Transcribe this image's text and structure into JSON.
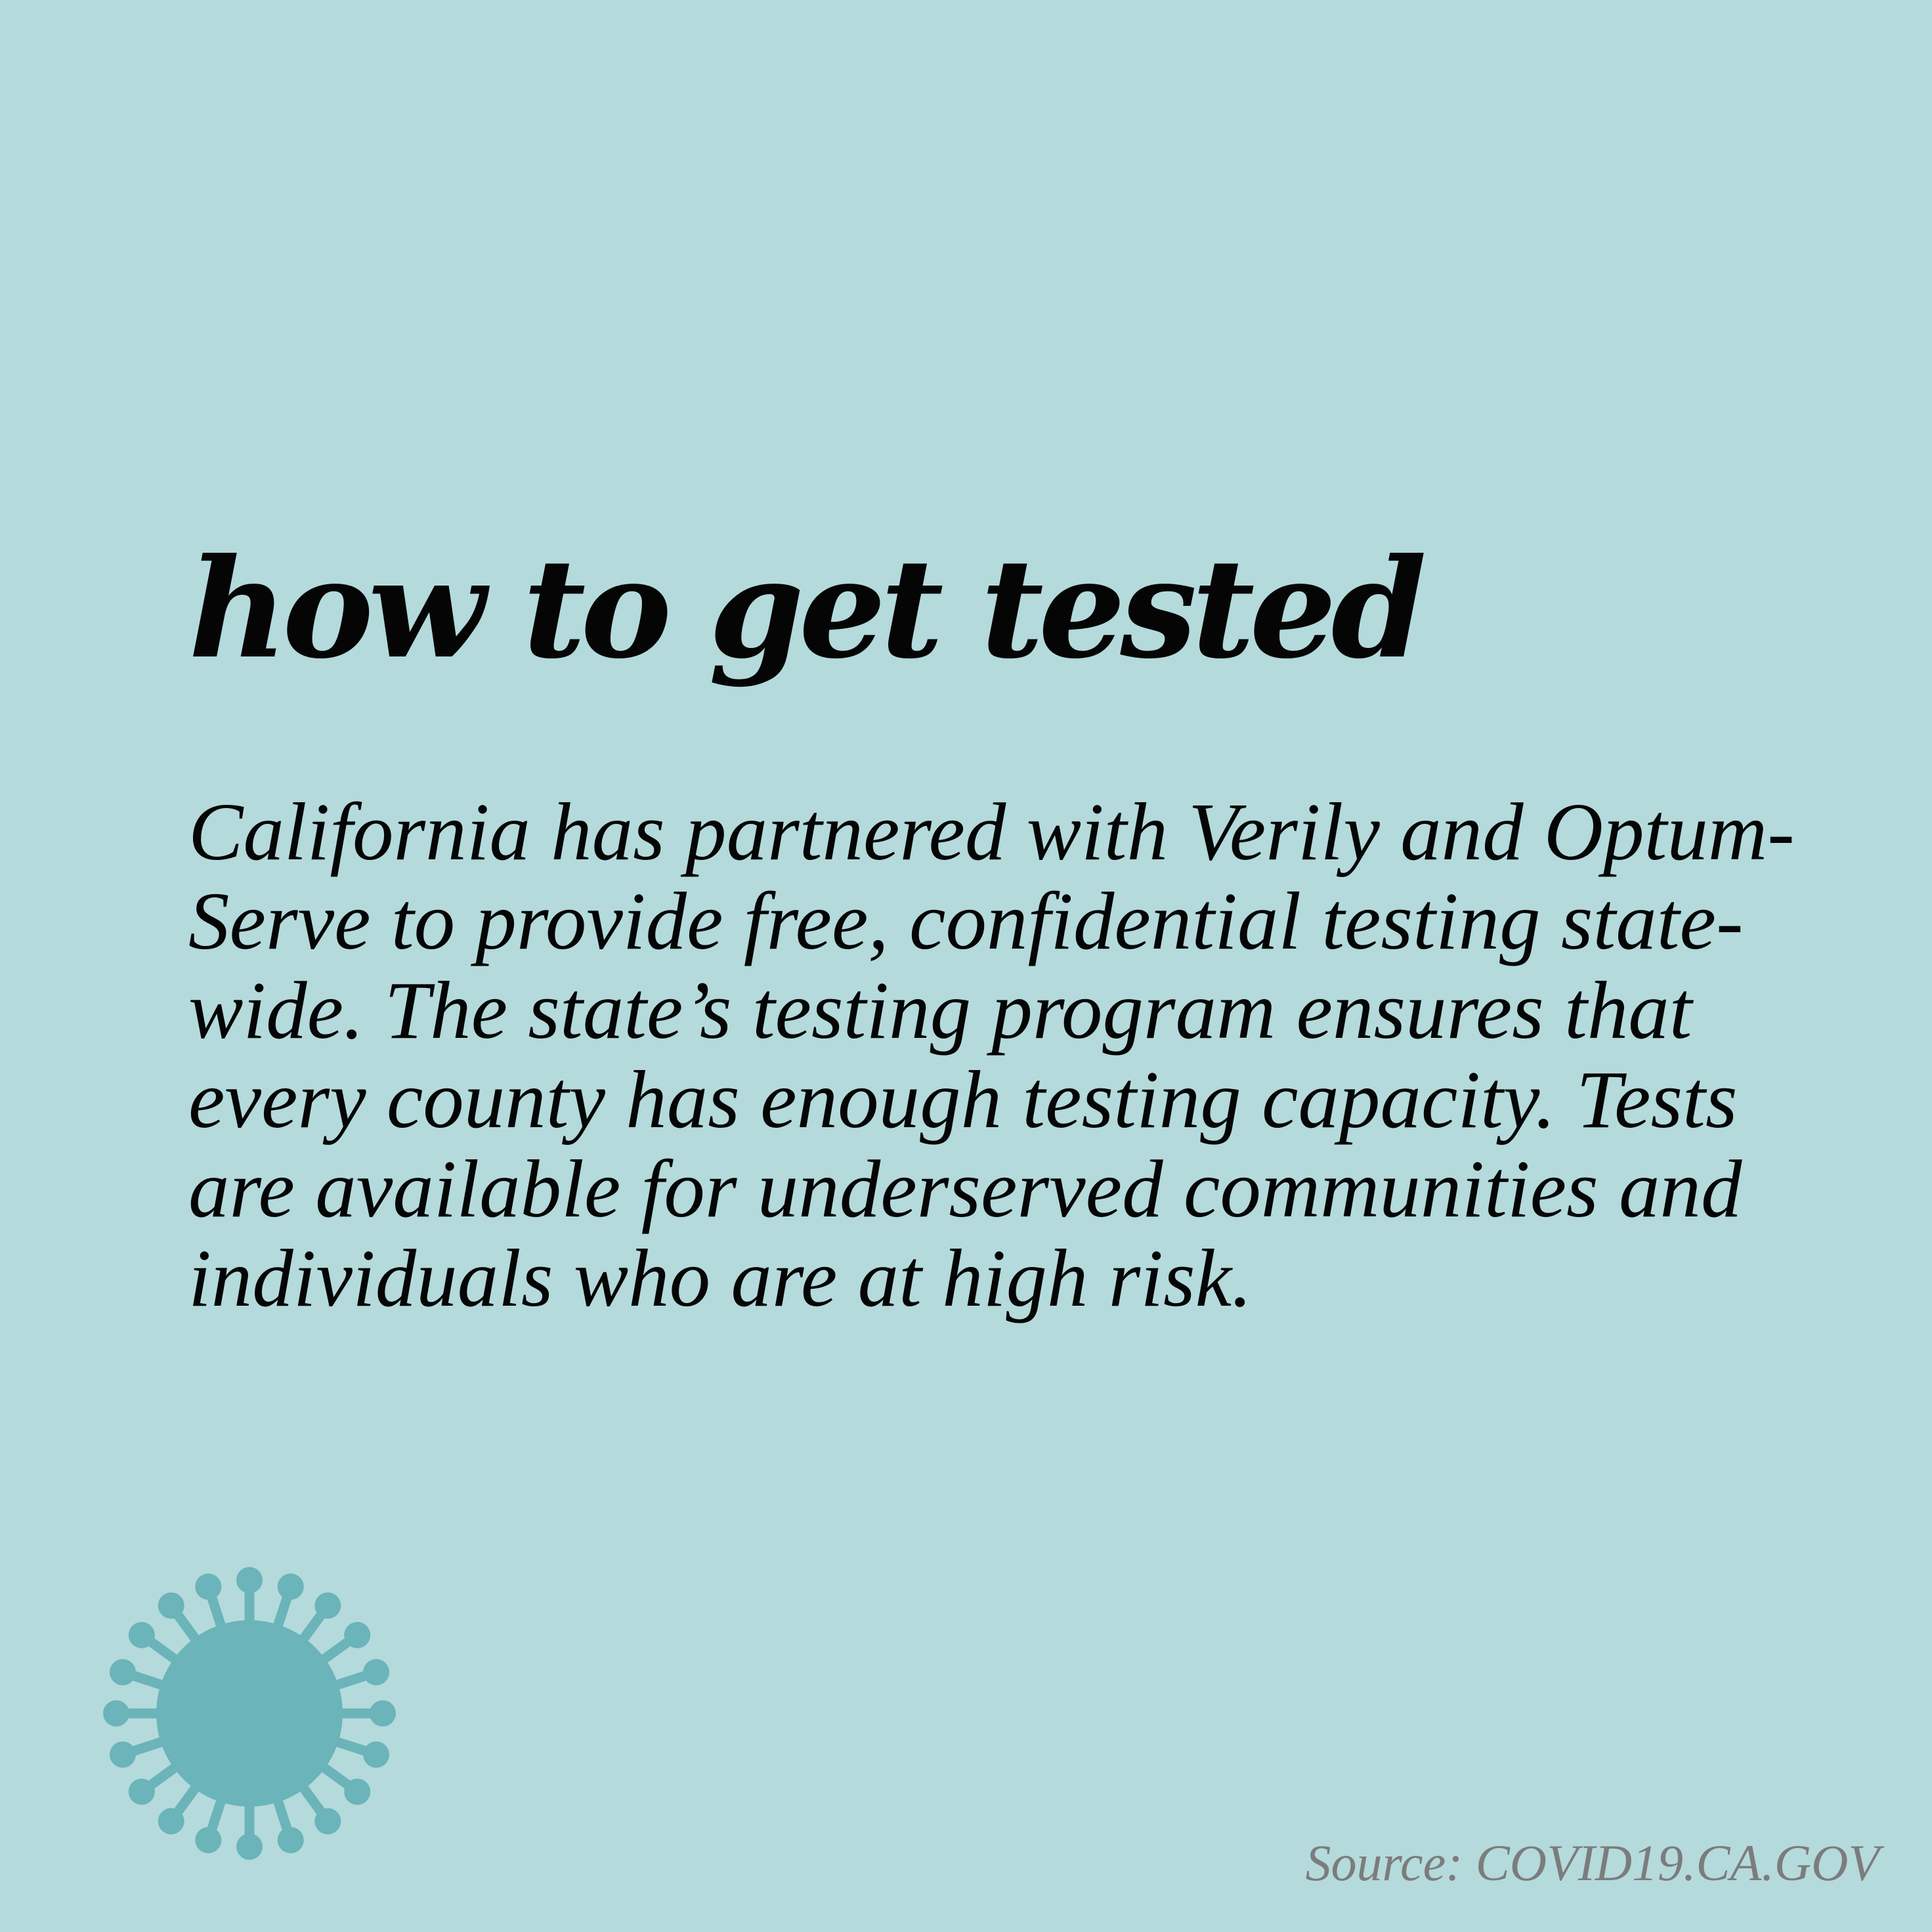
{
  "title": "how to get tested",
  "body": {
    "lines": [
      "California has partnered with Verily and Optum-",
      "Serve to provide free, confidential testing state-",
      "wide. The state’s testing program ensures that",
      "every county has enough testing capacity. Tests",
      "are available for underserved communities and",
      "individuals who are at high risk."
    ]
  },
  "source": "Source: COVID19.CA.GOV",
  "icons": {
    "virus": "virus-icon"
  },
  "colors": {
    "background": "#b4dadc",
    "text": "#050505",
    "virus": "#6bb4b9",
    "source": "#7c7c7c"
  }
}
